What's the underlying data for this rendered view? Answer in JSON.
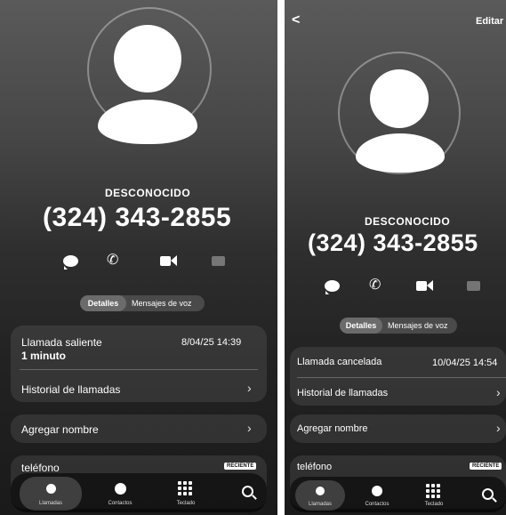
{
  "left": {
    "contact_label": "DESCONOCIDO",
    "phone_number": "(324) 343-2855",
    "tabs": {
      "details": "Detalles",
      "voicemail": "Mensajes de voz"
    },
    "call_entry": {
      "type": "Llamada saliente",
      "duration": "1 minuto",
      "datetime": "8/04/25 14:39"
    },
    "history_label": "Historial de llamadas",
    "add_name_label": "Agregar nombre",
    "phone_section": {
      "label": "teléfono",
      "badge": "RECIENTE"
    }
  },
  "right": {
    "back_glyph": "<",
    "edit_label": "Editar",
    "contact_label": "DESCONOCIDO",
    "phone_number": "(324) 343-2855",
    "tabs": {
      "details": "Detalles",
      "voicemail": "Mensajes de voz"
    },
    "call_entry": {
      "type": "Llamada cancelada",
      "datetime": "10/04/25 14:54"
    },
    "history_label": "Historial de llamadas",
    "add_name_label": "Agregar nombre",
    "phone_section": {
      "label": "teléfono",
      "badge": "RECIENTE"
    }
  },
  "nav": [
    "Llamadas",
    "Contactos",
    "Teclado",
    "Buscar"
  ],
  "colors": {
    "background_top": "#5a5a5a",
    "background_bottom": "#1a1a1a",
    "card": "#3a3a3a"
  }
}
